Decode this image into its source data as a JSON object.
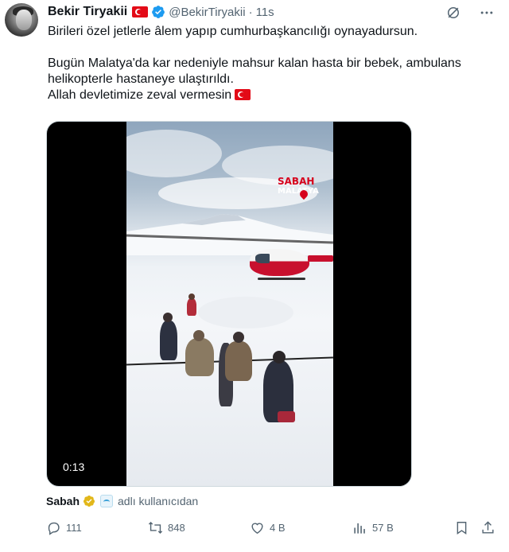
{
  "author": {
    "name": "Bekir Tiryakii",
    "handle": "@BekirTiryakii",
    "separator": "·",
    "time": "11s"
  },
  "tweet": {
    "line1": "Birileri özel jetlerle âlem yapıp cumhurbaşkancılığı oynayadursun.",
    "line2": "Bugün Malatya'da kar nedeniyle mahsur kalan hasta bir bebek, ambulans helikopterle hastaneye ulaştırıldı.",
    "line3": "Allah devletimize zeval vermesin"
  },
  "media": {
    "duration": "0:13",
    "watermark_brand": "SABAH",
    "watermark_city": "MALATYA"
  },
  "source": {
    "name": "Sabah",
    "suffix": "adlı kullanıcıdan"
  },
  "actions": {
    "replies": "111",
    "reposts": "848",
    "likes": "4 B",
    "views": "57 B"
  },
  "colors": {
    "verified": "#1d9bf0",
    "flag_red": "#e30a17",
    "muted_text": "#536471",
    "gold_badge": "#e2b719"
  },
  "icons": {
    "verified": "verified-badge-icon",
    "grok": "grok-icon",
    "more": "more-icon",
    "reply": "reply-icon",
    "repost": "repost-icon",
    "like": "like-icon",
    "views": "views-icon",
    "bookmark": "bookmark-icon",
    "share": "share-icon"
  }
}
